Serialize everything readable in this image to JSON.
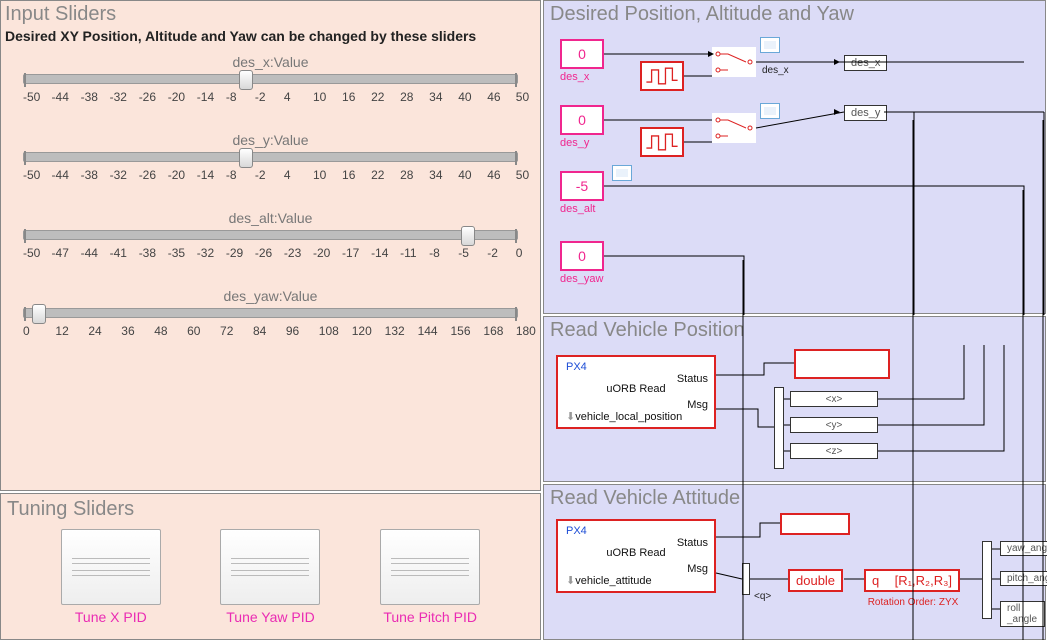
{
  "input_sliders": {
    "title": "Input Sliders",
    "subtitle": "Desired XY Position, Altitude and Yaw can be changed by these sliders",
    "sliders": [
      {
        "label": "des_x:Value",
        "min": -50,
        "max": 50,
        "value": -5,
        "ticks": [
          "-50",
          "-44",
          "-38",
          "-32",
          "-26",
          "-20",
          "-14",
          "-8",
          "-2",
          "4",
          "10",
          "16",
          "22",
          "28",
          "34",
          "40",
          "46",
          "50"
        ]
      },
      {
        "label": "des_y:Value",
        "min": -50,
        "max": 50,
        "value": -5,
        "ticks": [
          "-50",
          "-44",
          "-38",
          "-32",
          "-26",
          "-20",
          "-14",
          "-8",
          "-2",
          "4",
          "10",
          "16",
          "22",
          "28",
          "34",
          "40",
          "46",
          "50"
        ]
      },
      {
        "label": "des_alt:Value",
        "min": -50,
        "max": 0,
        "value": -5,
        "ticks": [
          "-50",
          "-47",
          "-44",
          "-41",
          "-38",
          "-35",
          "-32",
          "-29",
          "-26",
          "-23",
          "-20",
          "-17",
          "-14",
          "-11",
          "-8",
          "-5",
          "-2",
          "0"
        ]
      },
      {
        "label": "des_yaw:Value",
        "min": 0,
        "max": 180,
        "value": 5,
        "ticks": [
          "0",
          "12",
          "24",
          "36",
          "48",
          "60",
          "72",
          "84",
          "96",
          "108",
          "120",
          "132",
          "144",
          "156",
          "168",
          "180"
        ]
      }
    ]
  },
  "tuning": {
    "title": "Tuning Sliders",
    "blocks": [
      {
        "label": "Tune X PID"
      },
      {
        "label": "Tune Yaw PID"
      },
      {
        "label": "Tune Pitch PID"
      }
    ]
  },
  "desired_panel": {
    "title": "Desired Position, Altitude and Yaw",
    "constants": [
      {
        "name": "des_x",
        "value": "0"
      },
      {
        "name": "des_y",
        "value": "0"
      },
      {
        "name": "des_alt",
        "value": "-5"
      },
      {
        "name": "des_yaw",
        "value": "0"
      }
    ],
    "outports": [
      "des_x",
      "des_y"
    ],
    "switch_out_label": "des_x"
  },
  "rvp": {
    "title": "Read Vehicle Position",
    "block": {
      "vendor": "PX4",
      "name": "uORB Read",
      "topic": "vehicle_local_position",
      "out1": "Status",
      "out2": "Msg"
    },
    "bus_signals": [
      "<x>",
      "<y>",
      "<z>"
    ]
  },
  "rva": {
    "title": "Read Vehicle Attitude",
    "block": {
      "vendor": "PX4",
      "name": "uORB Read",
      "topic": "vehicle_attitude",
      "out1": "Status",
      "out2": "Msg"
    },
    "bus_signal": "<q>",
    "cast": "double",
    "rot_in": "q",
    "rot_out": "[R₁,R₂,R₃]",
    "rot_label": "Rotation Order: ZYX",
    "outs": [
      "yaw_angle",
      "pitch_angle",
      "roll _angle"
    ]
  }
}
